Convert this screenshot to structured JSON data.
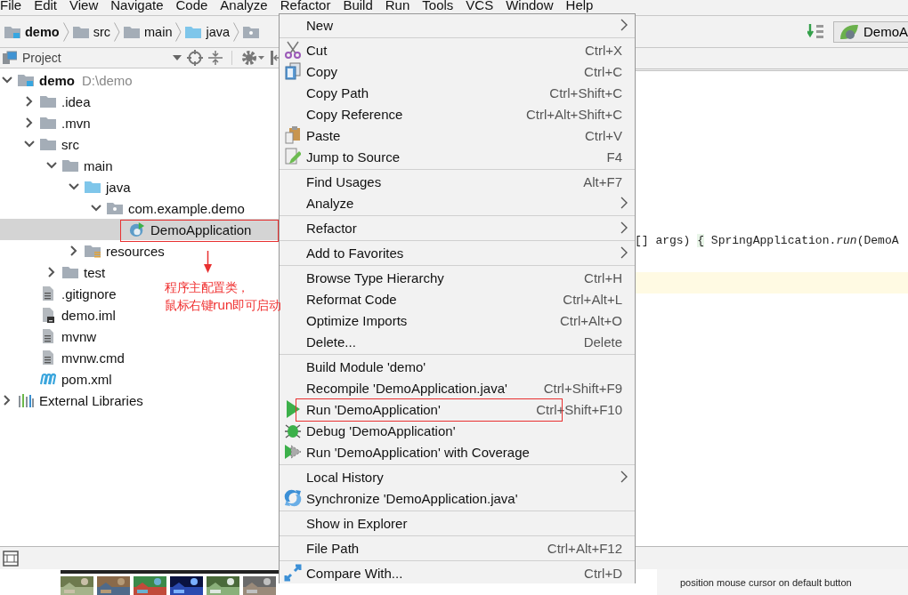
{
  "menu_bar": [
    "File",
    "Edit",
    "View",
    "Navigate",
    "Code",
    "Analyze",
    "Refactor",
    "Build",
    "Run",
    "Tools",
    "VCS",
    "Window",
    "Help"
  ],
  "nav_bar": {
    "breadcrumbs": [
      {
        "label": "demo",
        "kind": "module"
      },
      {
        "label": "src",
        "kind": "folder"
      },
      {
        "label": "main",
        "kind": "folder"
      },
      {
        "label": "java",
        "kind": "source-folder"
      },
      {
        "kind": "package"
      }
    ],
    "run_config": "DemoA"
  },
  "project_panel": {
    "title": "Project",
    "tree": [
      {
        "label": "demo",
        "path": "D:\\demo",
        "kind": "module",
        "expanded": true,
        "selected": false,
        "children": [
          {
            "label": ".idea",
            "kind": "folder",
            "expanded": false,
            "selected": false
          },
          {
            "label": ".mvn",
            "kind": "folder",
            "expanded": false,
            "selected": false
          },
          {
            "label": "src",
            "kind": "folder",
            "expanded": true,
            "selected": false,
            "children": [
              {
                "label": "main",
                "kind": "folder",
                "expanded": true,
                "selected": false,
                "children": [
                  {
                    "label": "java",
                    "kind": "source-folder",
                    "expanded": true,
                    "selected": false,
                    "children": [
                      {
                        "label": "com.example.demo",
                        "kind": "package",
                        "expanded": true,
                        "selected": false,
                        "children": [
                          {
                            "label": "DemoApplication",
                            "kind": "class",
                            "selected": true
                          }
                        ]
                      }
                    ]
                  },
                  {
                    "label": "resources",
                    "kind": "resource-folder",
                    "expanded": false,
                    "selected": false
                  }
                ]
              },
              {
                "label": "test",
                "kind": "folder",
                "expanded": false,
                "selected": false
              }
            ]
          },
          {
            "label": ".gitignore",
            "kind": "file",
            "selected": false
          },
          {
            "label": "demo.iml",
            "kind": "iml-file",
            "selected": false
          },
          {
            "label": "mvnw",
            "kind": "file",
            "selected": false
          },
          {
            "label": "mvnw.cmd",
            "kind": "file",
            "selected": false
          },
          {
            "label": "pom.xml",
            "kind": "maven-file",
            "selected": false
          }
        ]
      },
      {
        "label": "External Libraries",
        "kind": "libraries",
        "expanded": false,
        "selected": false
      }
    ]
  },
  "editor": {
    "code_line": {
      "before": "[] args) ",
      "brace": "{",
      "after": " SpringApplication.*run*(DemoA"
    }
  },
  "annotation": {
    "note_lines": [
      "程序主配置类，",
      "鼠标右键run即可启动"
    ]
  },
  "context_menu": {
    "groups": [
      [
        {
          "label": "New",
          "submenu": true
        }
      ],
      [
        {
          "label": "Cut",
          "shortcut": "Ctrl+X",
          "kind": "cut"
        },
        {
          "label": "Copy",
          "shortcut": "Ctrl+C",
          "kind": "copy"
        },
        {
          "label": "Copy Path",
          "shortcut": "Ctrl+Shift+C"
        },
        {
          "label": "Copy Reference",
          "shortcut": "Ctrl+Alt+Shift+C"
        },
        {
          "label": "Paste",
          "shortcut": "Ctrl+V",
          "kind": "paste"
        },
        {
          "label": "Jump to Source",
          "shortcut": "F4",
          "kind": "jump"
        }
      ],
      [
        {
          "label": "Find Usages",
          "shortcut": "Alt+F7"
        },
        {
          "label": "Analyze",
          "submenu": true
        }
      ],
      [
        {
          "label": "Refactor",
          "submenu": true
        }
      ],
      [
        {
          "label": "Add to Favorites",
          "submenu": true
        }
      ],
      [
        {
          "label": "Browse Type Hierarchy",
          "shortcut": "Ctrl+H"
        },
        {
          "label": "Reformat Code",
          "shortcut": "Ctrl+Alt+L"
        },
        {
          "label": "Optimize Imports",
          "shortcut": "Ctrl+Alt+O"
        },
        {
          "label": "Delete...",
          "shortcut": "Delete"
        }
      ],
      [
        {
          "label": "Build Module 'demo'"
        },
        {
          "label": "Recompile 'DemoApplication.java'",
          "shortcut": "Ctrl+Shift+F9"
        },
        {
          "label": "Run 'DemoApplication'",
          "shortcut": "Ctrl+Shift+F10",
          "kind": "run"
        },
        {
          "label": "Debug 'DemoApplication'",
          "kind": "debug"
        },
        {
          "label": "Run 'DemoApplication' with Coverage",
          "kind": "coverage"
        }
      ],
      [
        {
          "label": "Local History",
          "submenu": true
        },
        {
          "label": "Synchronize 'DemoApplication.java'",
          "kind": "sync"
        }
      ],
      [
        {
          "label": "Show in Explorer"
        }
      ],
      [
        {
          "label": "File Path",
          "shortcut": "Ctrl+Alt+F12"
        }
      ],
      [
        {
          "label": "Compare With...",
          "shortcut": "Ctrl+D",
          "kind": "compare"
        }
      ]
    ]
  },
  "taskbar": {
    "tooltip": "position mouse cursor on default button"
  }
}
